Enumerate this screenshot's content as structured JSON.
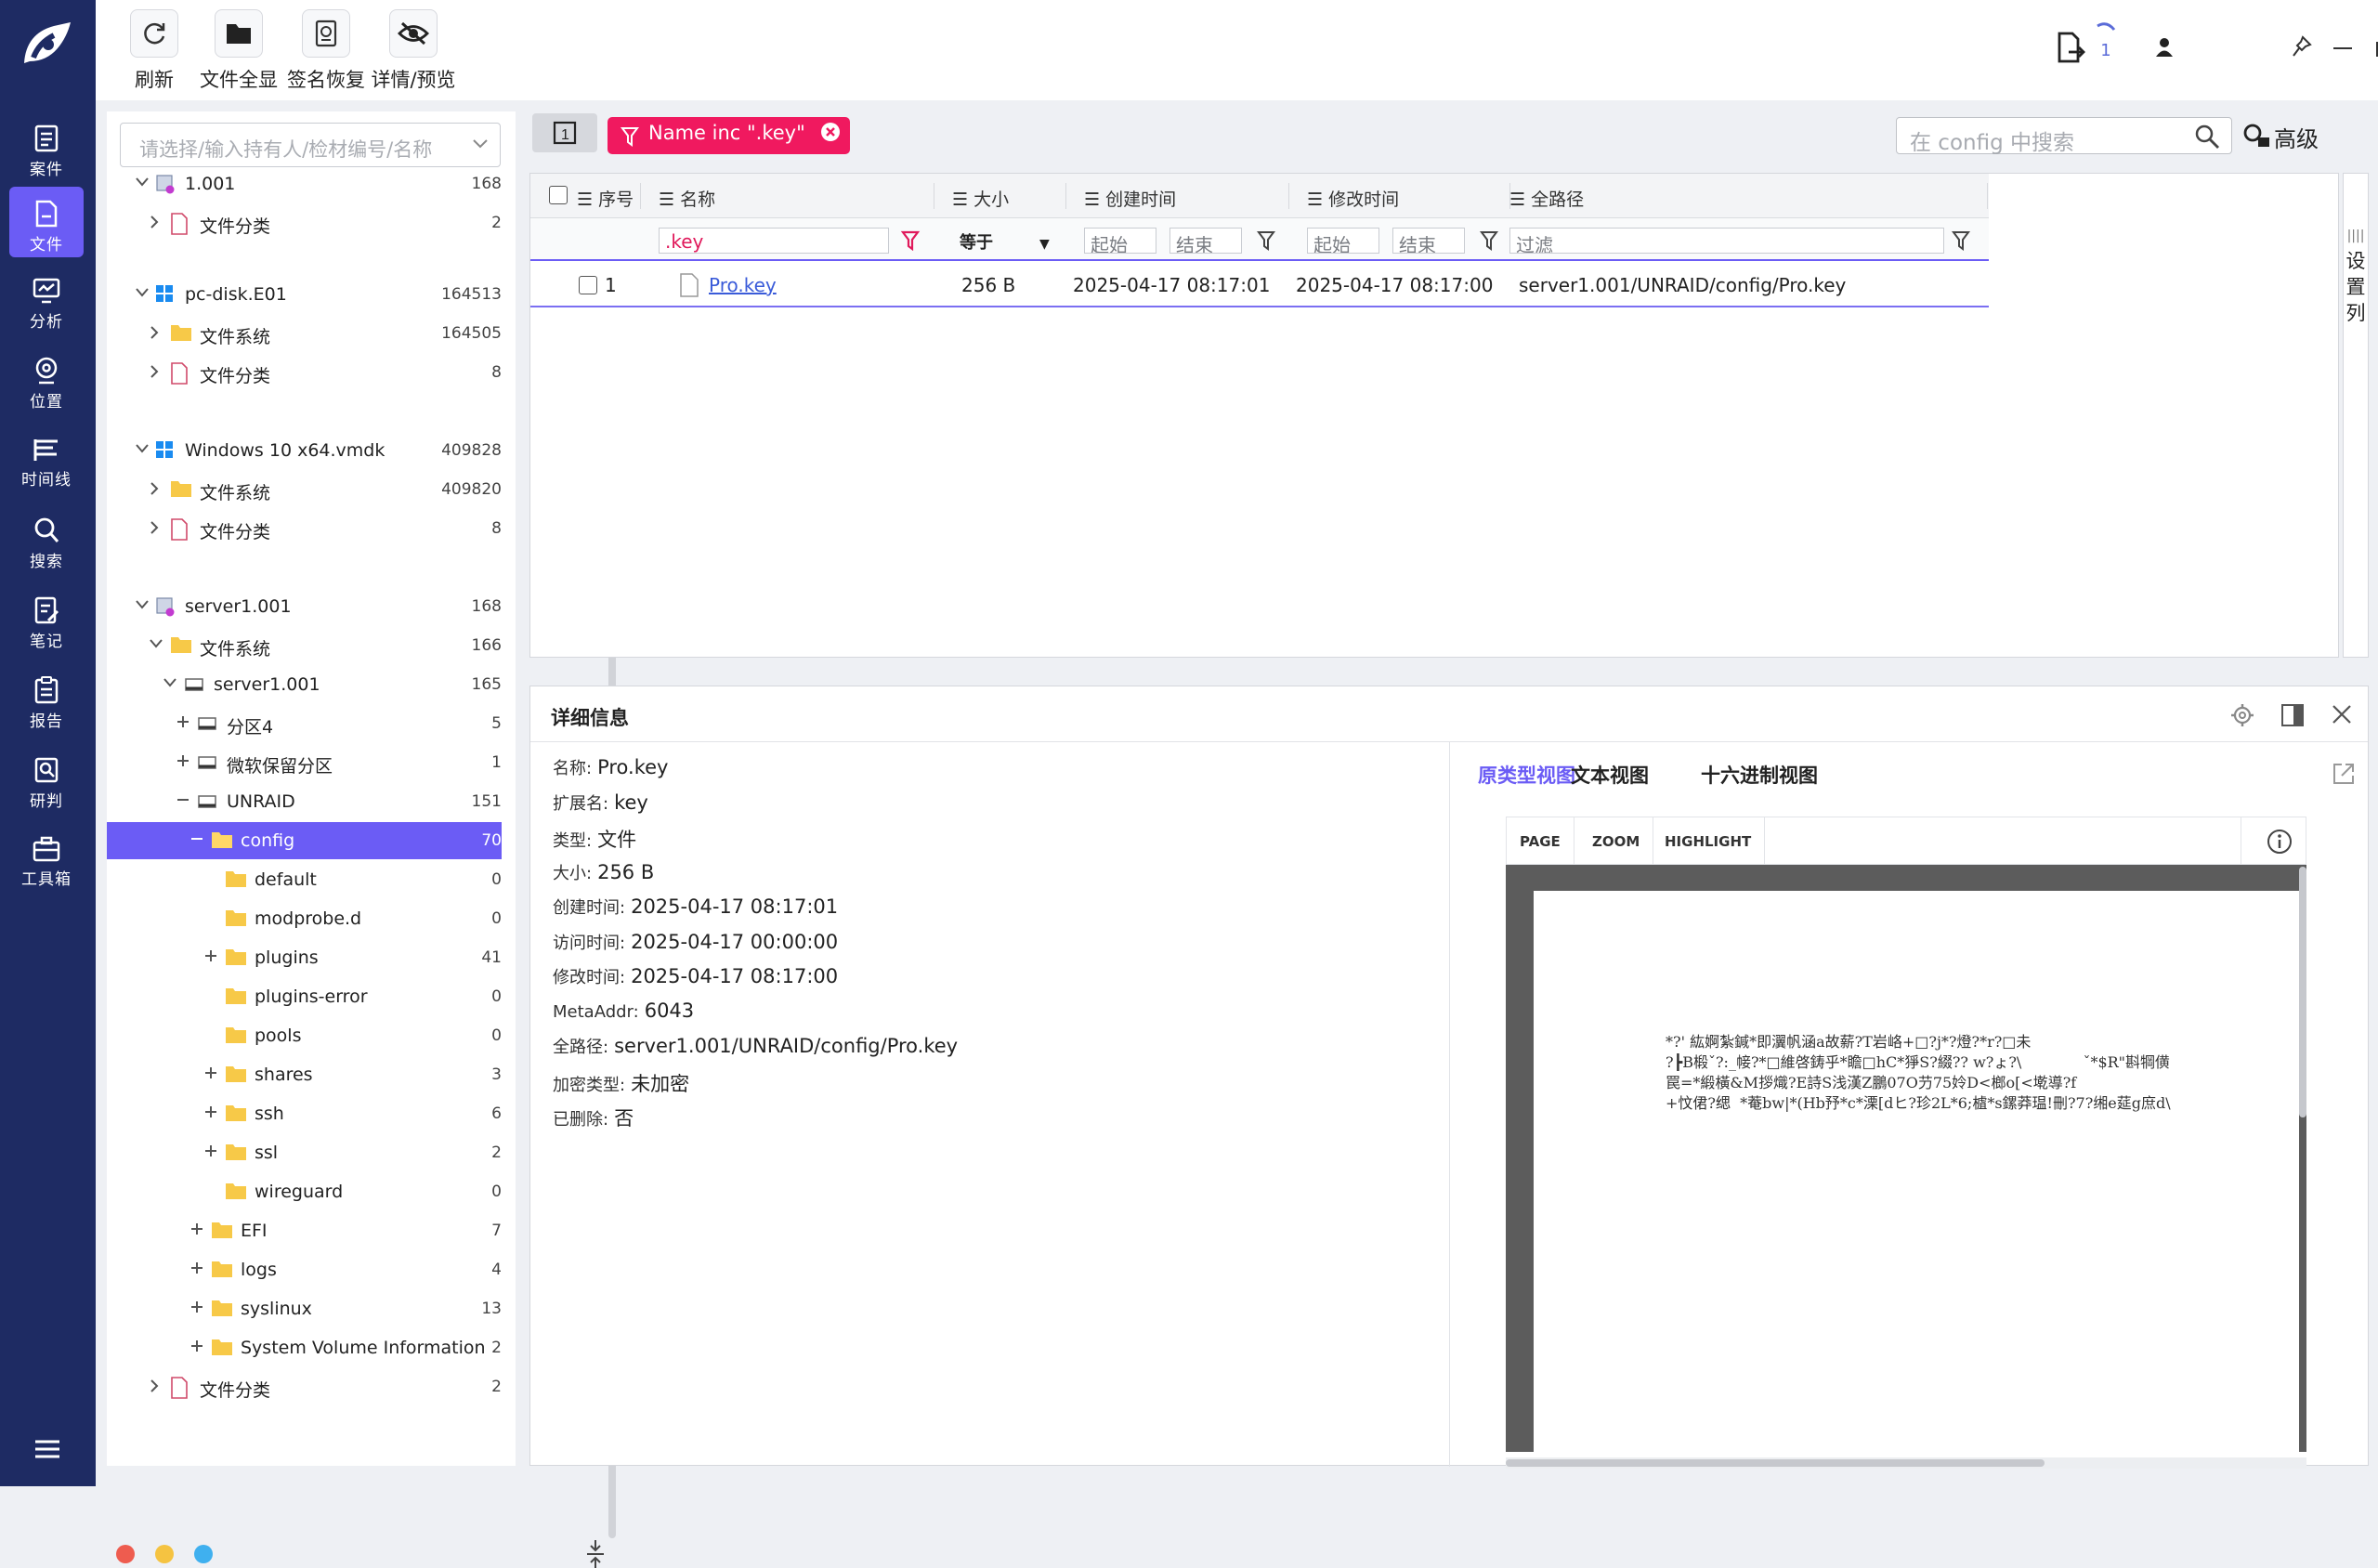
{
  "nav": {
    "items": [
      {
        "label": "案件",
        "icon": "case-icon"
      },
      {
        "label": "文件",
        "icon": "file-icon"
      },
      {
        "label": "分析",
        "icon": "analysis-icon"
      },
      {
        "label": "位置",
        "icon": "location-icon"
      },
      {
        "label": "时间线",
        "icon": "timeline-icon"
      },
      {
        "label": "搜索",
        "icon": "search-icon"
      },
      {
        "label": "笔记",
        "icon": "note-icon"
      },
      {
        "label": "报告",
        "icon": "report-icon"
      },
      {
        "label": "研判",
        "icon": "judge-icon"
      },
      {
        "label": "工具箱",
        "icon": "toolbox-icon"
      }
    ],
    "active": "文件",
    "active_color": "#6b5cf5",
    "bg_color": "#1e2b63"
  },
  "toolbar": {
    "refresh": "刷新",
    "show_all": "文件全显",
    "sign_recover": "签名恢复",
    "detail_preview": "详情/预览"
  },
  "window": {
    "task_count": "1"
  },
  "left": {
    "select_placeholder": "请选择/输入持有人/检材编号/名称",
    "tree": [
      {
        "label": "1.001",
        "count": "168"
      },
      {
        "label": "文件分类",
        "count": "2"
      },
      {
        "label": "pc-disk.E01",
        "count": "164513"
      },
      {
        "label": "文件系统",
        "count": "164505"
      },
      {
        "label": "文件分类",
        "count": "8"
      },
      {
        "label": "Windows 10 x64.vmdk",
        "count": "409828"
      },
      {
        "label": "文件系统",
        "count": "409820"
      },
      {
        "label": "文件分类",
        "count": "8"
      },
      {
        "label": "server1.001",
        "count": "168"
      },
      {
        "label": "文件系统",
        "count": "166"
      },
      {
        "label": "server1.001",
        "count": "165"
      },
      {
        "label": "分区4",
        "count": "5"
      },
      {
        "label": "微软保留分区",
        "count": "1"
      },
      {
        "label": "UNRAID",
        "count": "151"
      },
      {
        "label": "config",
        "count": "70"
      },
      {
        "label": "default",
        "count": "0"
      },
      {
        "label": "modprobe.d",
        "count": "0"
      },
      {
        "label": "plugins",
        "count": "41"
      },
      {
        "label": "plugins-error",
        "count": "0"
      },
      {
        "label": "pools",
        "count": "0"
      },
      {
        "label": "shares",
        "count": "3"
      },
      {
        "label": "ssh",
        "count": "6"
      },
      {
        "label": "ssl",
        "count": "2"
      },
      {
        "label": "wireguard",
        "count": "0"
      },
      {
        "label": "EFI",
        "count": "7"
      },
      {
        "label": "logs",
        "count": "4"
      },
      {
        "label": "syslinux",
        "count": "13"
      },
      {
        "label": "System Volume Information",
        "count": "2"
      },
      {
        "label": "文件分类",
        "count": "2"
      }
    ]
  },
  "filter_tag": "Name inc \".key\"",
  "page_badge": "1",
  "search_placeholder": "在 config 中搜索",
  "advanced": "高级",
  "table": {
    "headers": [
      "序号",
      "名称",
      "大小",
      "创建时间",
      "修改时间",
      "全路径"
    ],
    "filters": {
      "name": ".key",
      "size_op": "等于",
      "start": "起始",
      "end": "结束",
      "path": "过滤"
    },
    "rows": [
      {
        "no": "1",
        "name": "Pro.key",
        "size": "256 B",
        "created": "2025-04-17 08:17:01",
        "modified": "2025-04-17 08:17:00",
        "path": "server1.001/UNRAID/config/Pro.key"
      }
    ],
    "settings_col": "设置列"
  },
  "detail": {
    "title": "详细信息",
    "props": [
      {
        "k": "名称:",
        "v": "Pro.key"
      },
      {
        "k": "扩展名:",
        "v": "key"
      },
      {
        "k": "类型:",
        "v": "文件"
      },
      {
        "k": "大小:",
        "v": "256 B"
      },
      {
        "k": "创建时间:",
        "v": "2025-04-17 08:17:01"
      },
      {
        "k": "访问时间:",
        "v": "2025-04-17 00:00:00"
      },
      {
        "k": "修改时间:",
        "v": "2025-04-17 08:17:00"
      },
      {
        "k": "MetaAddr:",
        "v": "6043"
      },
      {
        "k": "全路径:",
        "v": "server1.001/UNRAID/config/Pro.key"
      },
      {
        "k": "加密类型:",
        "v": "未加密"
      },
      {
        "k": "已删除:",
        "v": "否"
      }
    ],
    "tabs": [
      "原类型视图",
      "文本视图",
      "十六进制视图"
    ],
    "viewer_buttons": [
      "PAGE",
      "ZOOM",
      "HIGHLIGHT"
    ],
    "garbled_lines": [
      "*?' 紘婀紮鍼*即瀷帆涵a故薪?T岩峈+□?j*?燈?*r?□未",
      "?┣B椴ˇ?:_帹?*□維啓鋳乎*瞻□hC*猙S?綴?? w?ょ?\\             ˇ*$R\"斟犅僙",
      "罠=*緞橫&M拶熾?E詩S浅漢Z鵬07O芀75姈D<榔o[<墘導?f",
      "+忟侰?缌  *菴bw|*(Hb㐨*c*溧[dヒ?珍2L*6;樝*s鏍莽瑥!刪?7?缃e莚g庶d\\"
    ]
  },
  "status_dots": [
    "#ee5c4f",
    "#f5c341",
    "#3fb0ef"
  ]
}
